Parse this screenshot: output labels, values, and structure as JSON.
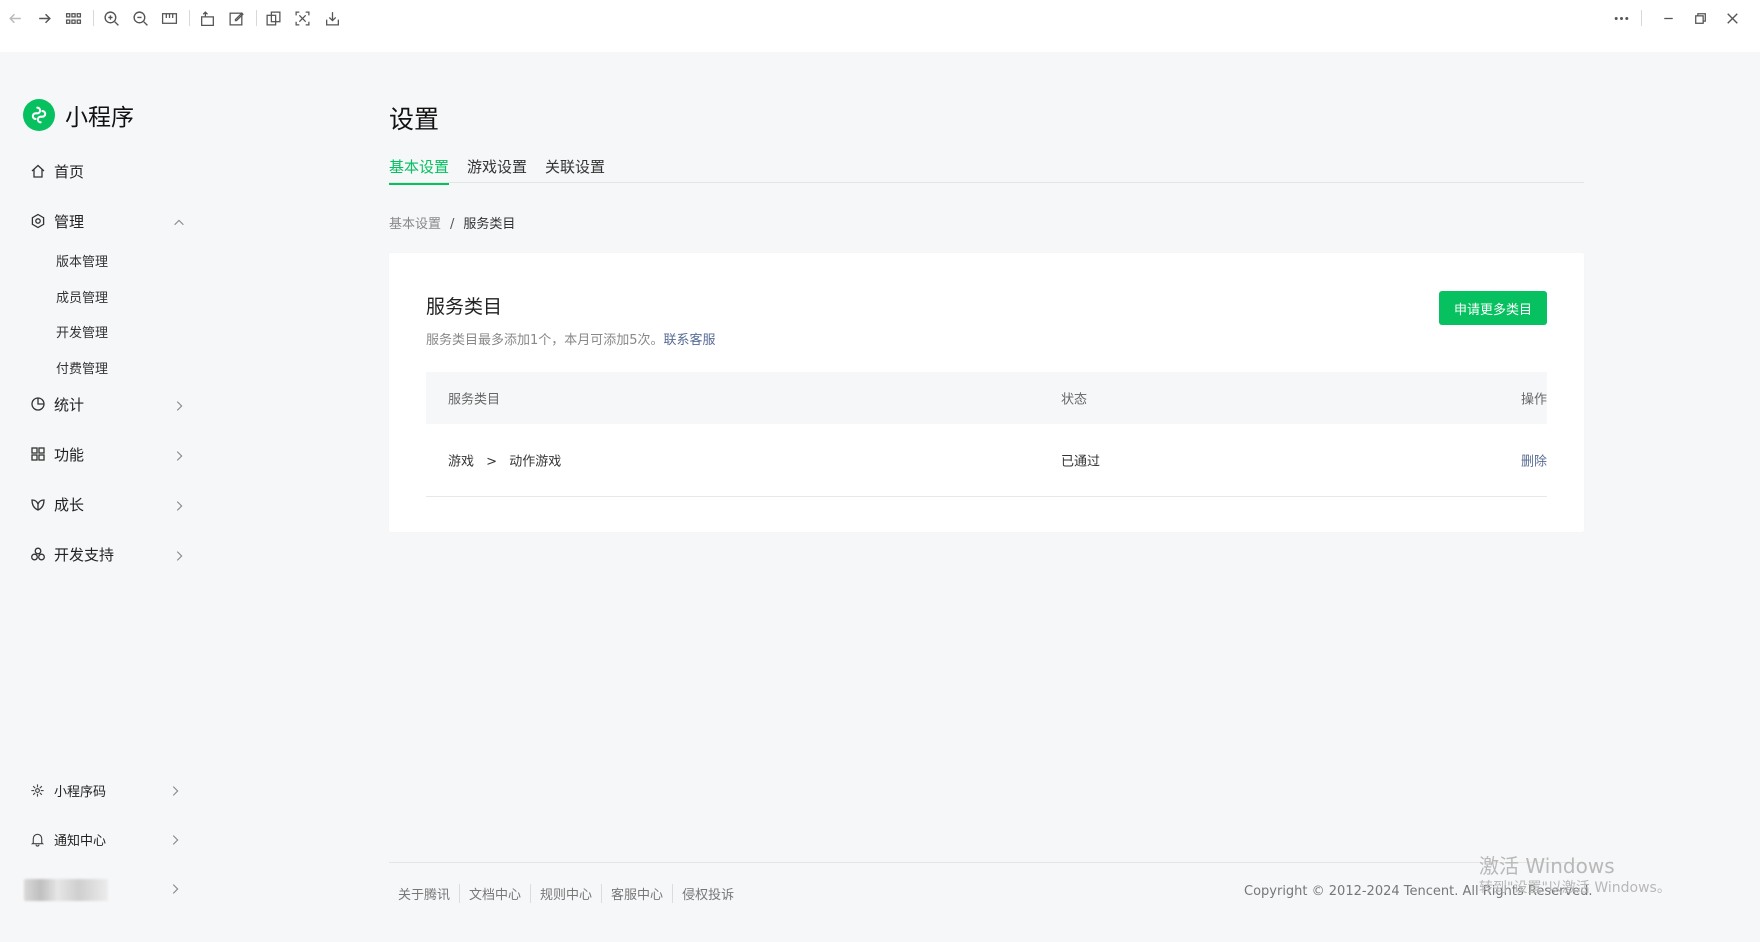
{
  "toolbar": {
    "left_icons": [
      "back-icon",
      "forward-icon",
      "grid-icon",
      "zoom-in-icon",
      "zoom-out-icon",
      "ruler-icon",
      "rotate-icon",
      "edit-icon",
      "copy-icon",
      "scan-icon",
      "download-icon"
    ],
    "right_icons": [
      "more-icon",
      "minimize-icon",
      "restore-icon",
      "close-icon"
    ]
  },
  "sidebar": {
    "app_name": "小程序",
    "items": [
      {
        "label": "首页",
        "icon": "home-icon"
      },
      {
        "label": "管理",
        "icon": "settings-icon",
        "expanded": true,
        "children": [
          "版本管理",
          "成员管理",
          "开发管理",
          "付费管理"
        ]
      },
      {
        "label": "统计",
        "icon": "pie-chart-icon"
      },
      {
        "label": "功能",
        "icon": "apps-icon"
      },
      {
        "label": "成长",
        "icon": "growth-icon"
      },
      {
        "label": "开发支持",
        "icon": "dev-support-icon"
      }
    ],
    "bottom_items": [
      {
        "label": "小程序码",
        "icon": "miniprogram-code-icon"
      },
      {
        "label": "通知中心",
        "icon": "bell-icon"
      }
    ]
  },
  "main": {
    "title": "设置",
    "tabs": [
      {
        "label": "基本设置",
        "active": true
      },
      {
        "label": "游戏设置",
        "active": false
      },
      {
        "label": "关联设置",
        "active": false
      }
    ],
    "breadcrumb": {
      "parent": "基本设置",
      "separator": "/",
      "current": "服务类目"
    },
    "card": {
      "title": "服务类目",
      "desc": "服务类目最多添加1个，本月可添加5次。",
      "desc_link": "联系客服",
      "apply_button": "申请更多类目",
      "table": {
        "headers": [
          "服务类目",
          "状态",
          "操作"
        ],
        "rows": [
          {
            "category": "游戏",
            "arrow": ">",
            "subcategory": "动作游戏",
            "status": "已通过",
            "action": "删除"
          }
        ]
      }
    }
  },
  "footer": {
    "links": [
      "关于腾讯",
      "文档中心",
      "规则中心",
      "客服中心",
      "侵权投诉"
    ],
    "copyright": "Copyright © 2012-2024 Tencent. All Rights Reserved."
  },
  "watermark": {
    "line1": "激活 Windows",
    "line2": "转到\"设置\"以激活 Windows。"
  },
  "colors": {
    "accent": "#07c160",
    "link": "#576b95",
    "bg": "#f6f7f9"
  }
}
